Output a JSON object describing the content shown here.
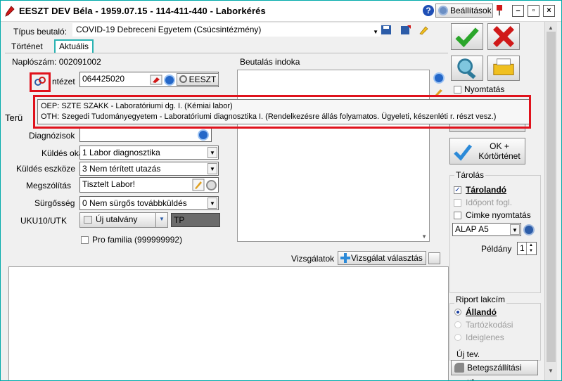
{
  "window": {
    "title": "EESZT DEV Béla - 1959.07.15 - 114-411-440 - Laborkérés",
    "settings_label": "Beállítások",
    "help_label": "?"
  },
  "header": {
    "tipus_label": "Típus beutaló:",
    "tipus_value": "COVID-19 Debreceni Egyetem (Csúcsintézmény)"
  },
  "tabs": [
    {
      "label": "Történet"
    },
    {
      "label": "Aktuális"
    }
  ],
  "form": {
    "naploszam": "Naplószám: 002091002",
    "intezet_label": "ntézet",
    "intezet_value": "064425020",
    "eeszt_label": "EESZT",
    "teru_label": "Terü",
    "diagnozisok_label": "Diagnózisok",
    "kuldes_oka_label": "Küldés oka",
    "kuldes_oka_value": "1 Labor diagnosztika",
    "kuldes_eszkoze_label": "Küldés eszköze",
    "kuldes_eszkoze_value": "3 Nem térített utazás",
    "megszolitas_label": "Megszólítás",
    "megszolitas_value": "Tisztelt Labor!",
    "surgosseg_label": "Sürgősség",
    "surgosseg_value": "0 Nem sürgős továbbküldés",
    "uku_label": "UKU10/UTK",
    "uj_utalvany_label": "Új utalvány",
    "tp_value": "TP",
    "pro_familia_label": "Pro familia (999999992)"
  },
  "beutalas": {
    "label": "Beutalás indoka"
  },
  "vizsgalatok": {
    "label": "Vizsgálatok",
    "button_label": "Vizsgálat választás"
  },
  "tooltip": {
    "line1": "OEP: SZTE SZAKK - Laboratóriumi dg. I. (Kémiai labor)",
    "line2": "OTH: Szegedi Tudományegyetem - Laboratóriumi diagnosztika I. (Rendelkezésre állás folyamatos. Ügyeleti, készenléti r. részt vesz.)"
  },
  "right": {
    "nyomtatas_label": "Nyomtatás",
    "ok_kortortenet_line1": "OK +",
    "ok_kortortenet_line2": "Kórtörténet",
    "tarolas_title": "Tárolás",
    "tarolando_label": "Tárolandó",
    "idopont_label": "Időpont fogl.",
    "cimke_label": "Cimke nyomtatás",
    "alap_value": "ALAP A5",
    "peldany_label": "Példány",
    "peldany_value": "1",
    "riport_title": "Riport lakcím",
    "allando_label": "Állandó",
    "tartozkodasi_label": "Tartózkodási",
    "ideiglenes_label": "Ideiglenes",
    "uj_tev_label": "Új tev.",
    "betegszallitasi_label": "Betegszállítási ut..."
  },
  "colors": {
    "accent": "#2bb3b3",
    "highlight": "#e0121c",
    "ok_green": "#2aa52a",
    "cancel_red": "#d01818"
  }
}
